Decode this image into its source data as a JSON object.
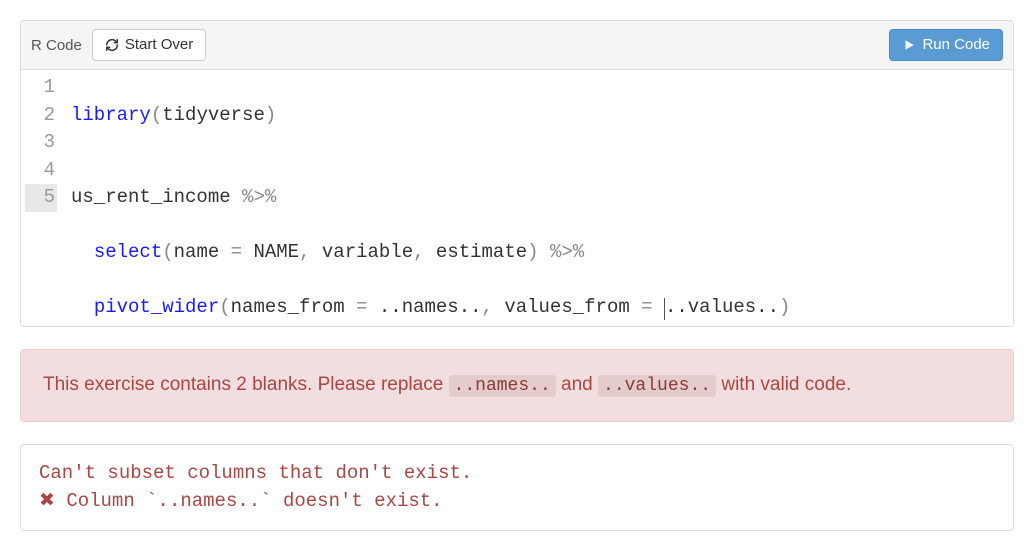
{
  "toolbar": {
    "label": "R Code",
    "start_over": "Start Over",
    "run_code": "Run Code"
  },
  "editor": {
    "line_numbers": [
      "1",
      "2",
      "3",
      "4",
      "5"
    ],
    "active_line": 5,
    "lines": {
      "l1": {
        "fn": "library",
        "lp": "(",
        "arg": "tidyverse",
        "rp": ")"
      },
      "l2": {
        "blank": ""
      },
      "l3": {
        "obj": "us_rent_income",
        "sp": " ",
        "pipe": "%>%"
      },
      "l4": {
        "indent": "  ",
        "fn": "select",
        "lp": "(",
        "a1k": "name",
        "sp1": " ",
        "eq1": "=",
        "sp2": " ",
        "a1v": "NAME",
        "c1": ",",
        "sp3": " ",
        "a2": "variable",
        "c2": ",",
        "sp4": " ",
        "a3": "estimate",
        "rp": ")",
        "sp5": " ",
        "pipe": "%>%"
      },
      "l5": {
        "indent": "  ",
        "fn": "pivot_wider",
        "lp": "(",
        "k1": "names_from",
        "sp1": " ",
        "eq1": "=",
        "sp2": " ",
        "v1": "..names..",
        "c1": ",",
        "sp3": " ",
        "k2": "values_from",
        "sp4": " ",
        "eq2": "=",
        "sp5": " ",
        "v2": "..values..",
        "rp": ")"
      }
    }
  },
  "hint": {
    "pre": "This exercise contains 2 blanks. Please replace ",
    "blank1": "..names..",
    "mid": " and ",
    "blank2": "..values..",
    "post": " with valid code."
  },
  "error": {
    "line1": "Can't subset columns that don't exist.",
    "x": "✖",
    "line2": " Column `..names..` doesn't exist."
  }
}
